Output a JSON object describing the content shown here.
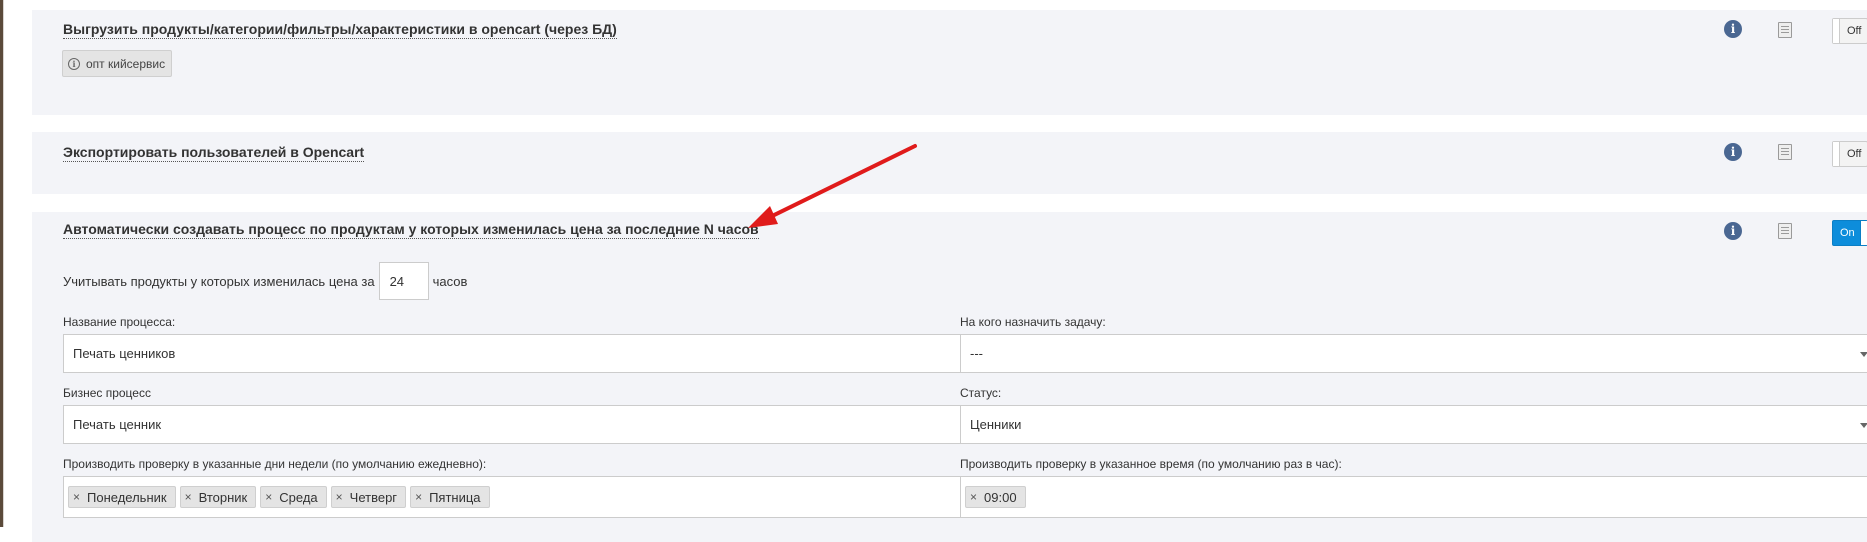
{
  "colors": {
    "toggle_on": "#0d8ddb",
    "info_icon": "#4a6792",
    "panel_bg": "#f3f4f8",
    "arrow": "#e01b1b"
  },
  "rows": [
    {
      "title": "Выгрузить продукты/категории/фильтры/характеристики в opencart (через БД)",
      "tag": "опт кийсервис",
      "toggle": "Off"
    },
    {
      "title": "Экспортировать пользователей в Opencart",
      "toggle": "Off"
    },
    {
      "title": "Автоматически создавать процесс по продуктам у которых изменилась цена за последние N часов",
      "toggle": "On",
      "hours": {
        "label_before": "Учитывать продукты у которых изменилась цена за",
        "value": "24",
        "label_after": "часов"
      },
      "process_name": {
        "label": "Название процесса:",
        "value": "Печать ценников"
      },
      "assignee": {
        "label": "На кого назначить задачу:",
        "value": "---"
      },
      "business_process": {
        "label": "Бизнес процесс",
        "value": "Печать ценник"
      },
      "status": {
        "label": "Статус:",
        "value": "Ценники"
      },
      "days": {
        "label": "Производить проверку в указанные дни недели (по умолчанию ежедневно):",
        "chips": [
          "Понедельник",
          "Вторник",
          "Среда",
          "Четверг",
          "Пятница"
        ]
      },
      "time": {
        "label": "Производить проверку в указанное время (по умолчанию раз в час):",
        "chips": [
          "09:00"
        ]
      }
    }
  ],
  "icons": {
    "info": "info-icon",
    "copy": "copy-icon",
    "close": "close-icon",
    "clock": "clock-icon",
    "chip_remove": "×",
    "close_glyph": "✕"
  }
}
